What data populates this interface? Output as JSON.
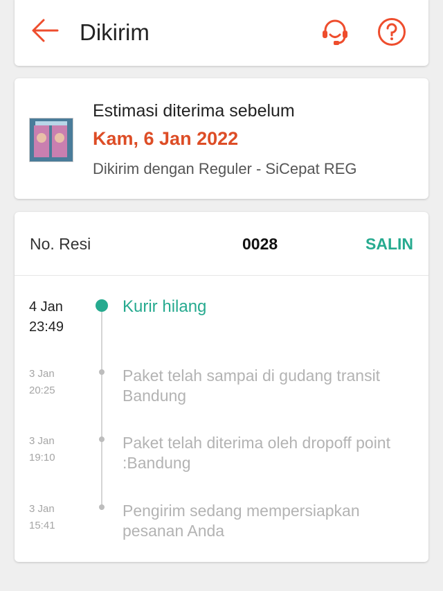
{
  "header": {
    "title": "Dikirim",
    "back_icon": "arrow-left-icon",
    "cs_icon": "headset-icon",
    "help_icon": "question-circle-icon"
  },
  "estimate": {
    "title": "Estimasi diterima sebelum",
    "date": "Kam, 6 Jan 2022",
    "shipping": "Dikirim dengan Reguler - SiCepat REG"
  },
  "tracking": {
    "resi_label": "No. Resi",
    "resi_number": "0028",
    "copy_label": "SALIN",
    "events": [
      {
        "date": "4 Jan",
        "time": "23:49",
        "status": "Kurir hilang",
        "active": true
      },
      {
        "date": "3 Jan",
        "time": "20:25",
        "status": "Paket telah sampai di gudang transit Bandung",
        "active": false
      },
      {
        "date": "3 Jan",
        "time": "19:10",
        "status": "Paket telah diterima oleh dropoff point :Bandung",
        "active": false
      },
      {
        "date": "3 Jan",
        "time": "15:41",
        "status": "Pengirim sedang mempersiapkan pesanan Anda",
        "active": false
      }
    ]
  },
  "colors": {
    "accent": "#ee4d2d",
    "date_highlight": "#dd4d26",
    "teal": "#26aa8f",
    "muted": "#b3b3b3"
  }
}
